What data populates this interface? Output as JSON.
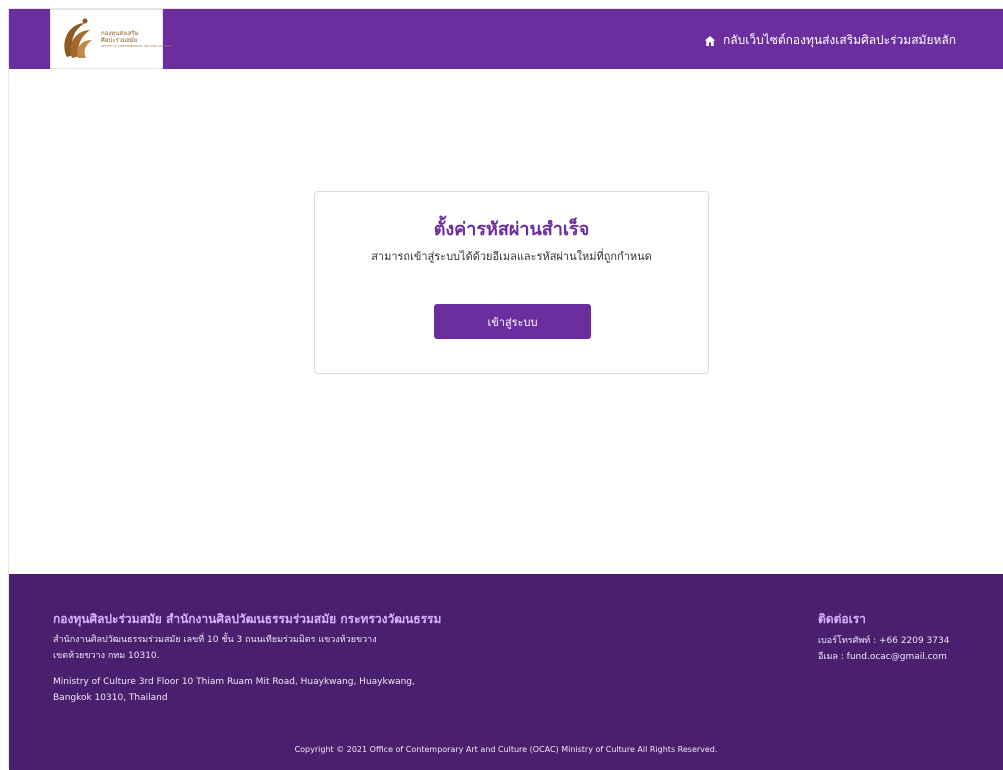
{
  "header": {
    "logo_text_line1": "กองทุนส่งเสริม",
    "logo_text_line2": "ศิลปะร่วมสมัย",
    "logo_text_line3": "OFFICE OF CONTEMPORARY ART AND CULTURE",
    "home_link": "กลับเว็บไซต์กองทุนส่งเสริมศิลปะร่วมสมัยหลัก"
  },
  "main": {
    "title": "ตั้งค่ารหัสผ่านสำเร็จ",
    "subtitle": "สามารถเข้าสู่ระบบได้ด้วยอีเมลและรหัสผ่านใหม่ที่ถูกกำหนด",
    "button": "เข้าสู่ระบบ"
  },
  "footer": {
    "title": "กองทุนศิลปะร่วมสมัย สำนักงานศิลปวัฒนธรรมร่วมสมัย กระทรวงวัฒนธรรม",
    "address_th_1": "สำนักงานศิลปวัฒนธรรมร่วมสมัย เลขที่ 10 ชั้น 3 ถนนเทียมร่วมมิตร แขวงห้วยขวาง",
    "address_th_2": "เขตห้วยขวาง กทม 10310.",
    "address_en_1": "Ministry of Culture 3rd Floor 10 Thiam Ruam Mit Road, Huaykwang, Huaykwang,",
    "address_en_2": "Bangkok 10310, Thailand",
    "contact_title": "ติดต่อเรา",
    "phone": "เบอร์โทรศัพท์ : +66 2209 3734",
    "email": "อีเมล : fund.ocac@gmail.com",
    "copyright": "Copyright © 2021 Office of Contemporary Art and Culture (OCAC) Ministry of Culture All Rights Reserved."
  },
  "colors": {
    "primary_purple": "#6b2e9e",
    "footer_purple": "#4a1f6d",
    "accent_purple": "#d8b3ff"
  },
  "icons": {
    "home": "home-icon",
    "logo": "ocac-logo-icon"
  }
}
